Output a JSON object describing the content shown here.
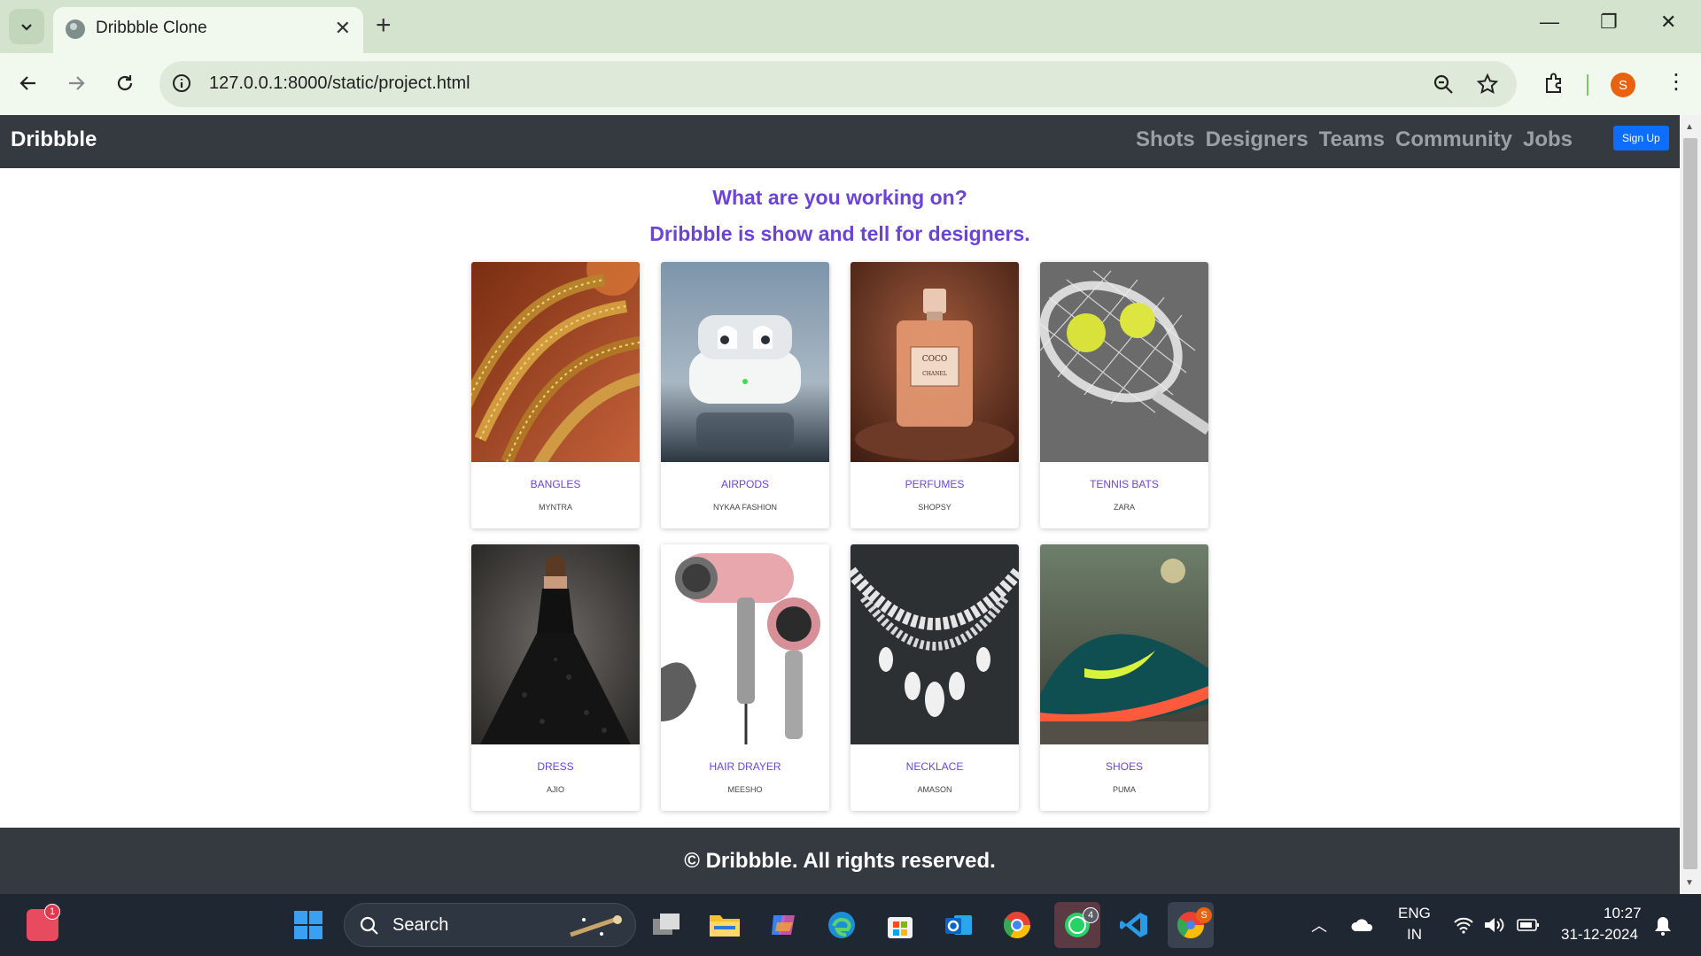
{
  "browser": {
    "tab_title": "Dribbble Clone",
    "url": "127.0.0.1:8000/static/project.html",
    "profile_initial": "S"
  },
  "site": {
    "brand": "Dribbble",
    "nav": [
      "Shots",
      "Designers",
      "Teams",
      "Community",
      "Jobs"
    ],
    "signup_label": "Sign Up",
    "heading_line1": "What are you working on?",
    "heading_line2": "Dribbble is show and tell for designers.",
    "cards": [
      {
        "title": "BANGLES",
        "subtitle": "MYNTRA",
        "image": "bangles-photo"
      },
      {
        "title": "AIRPODS",
        "subtitle": "NYKAA FASHION",
        "image": "airpods-photo"
      },
      {
        "title": "PERFUMES",
        "subtitle": "SHOPSY",
        "image": "perfume-photo"
      },
      {
        "title": "TENNIS BATS",
        "subtitle": "ZARA",
        "image": "tennis-racket-photo"
      },
      {
        "title": "DRESS",
        "subtitle": "AJIO",
        "image": "dress-photo"
      },
      {
        "title": "HAIR DRAYER",
        "subtitle": "MEESHO",
        "image": "hair-dryer-photo"
      },
      {
        "title": "NECKLACE",
        "subtitle": "AMASON",
        "image": "necklace-photo"
      },
      {
        "title": "SHOES",
        "subtitle": "PUMA",
        "image": "shoes-photo"
      }
    ],
    "footer": "© Dribbble. All rights reserved."
  },
  "taskbar": {
    "search_label": "Search",
    "notification_count": "1",
    "whatsapp_badge": "4",
    "chrome_badge": "S",
    "language": "ENG",
    "region": "IN",
    "time": "10:27",
    "date": "31-12-2024"
  },
  "colors": {
    "accent": "#6c43d9",
    "navbar": "#343a40",
    "signup": "#0d6efd"
  }
}
